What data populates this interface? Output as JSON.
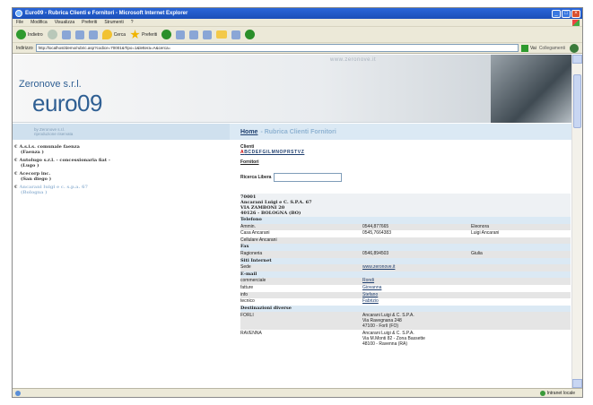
{
  "window": {
    "title": "Euro09 - Rubrica Clienti e Fornitori - Microsoft Internet Explorer",
    "minimize": "_",
    "maximize": "□",
    "close": "×"
  },
  "menu": [
    "File",
    "Modifica",
    "Visualizza",
    "Preferiti",
    "Strumenti",
    "?"
  ],
  "toolbar": {
    "back": "Indietro",
    "search": "Cerca",
    "favorites": "Preferiti"
  },
  "address": {
    "label": "Indirizzo",
    "url": "http://localhost/demo/rubric.asp?codice=70001&Tipo=1&lettera=A&cerca=",
    "go": "Vai",
    "links": "Collegamenti"
  },
  "header": {
    "company": "Zeronove s.r.l.",
    "brand": "euro09",
    "website": "www.zeronove.it",
    "byline_1": "by Zeronove s.r.l.",
    "byline_2": "riproduzione riservata"
  },
  "breadcrumb": {
    "home": "Home",
    "current": "- Rubrica Clienti Fornitori"
  },
  "sidebar": {
    "items": [
      {
        "name": "A.s.i.s. comunale faenza",
        "city": "(Faenza )"
      },
      {
        "name": "Autolugo s.r.l. - concessionaria fiat -",
        "city": "(Lugo )"
      },
      {
        "name": "Acecorp inc.",
        "city": "(San diego )"
      },
      {
        "name": "Ancarani luigi e c. s.p.a. 67",
        "city": "(Bologna )"
      }
    ]
  },
  "main": {
    "clienti_label": "Clienti",
    "alphabet_first": "A",
    "alphabet_rest": "BCDEFGILMNOPRSTVZ",
    "fornitori_label": "Fornitori",
    "ricerca_label": "Ricerca Libera",
    "ricerca_value": "",
    "code": "70001",
    "company": "Ancarani Luigi e C. S.P.A. 67",
    "street": "VIA ZAMBONI 20",
    "cityline": "40126 - BOLOGNA (BO)"
  },
  "details": {
    "telefono_label": "Telefono",
    "telefono": [
      [
        "Ammin.",
        "0544,877665",
        "Eleonora"
      ],
      [
        "Casa Ancarani",
        "0545,7664383",
        "Luigi Ancarani"
      ],
      [
        "Cellulare Ancarani",
        "",
        ""
      ]
    ],
    "fax_label": "Fax",
    "fax": [
      [
        "Ragioneria",
        "0546,894503",
        "Giulia"
      ]
    ],
    "siti_label": "Siti Internet",
    "siti": [
      [
        "Sede",
        "www.zeronove.it",
        ""
      ]
    ],
    "email_label": "E-mail",
    "email": [
      [
        "commerciale",
        "Rondi"
      ],
      [
        "fatture",
        "Giovanna"
      ],
      [
        "info",
        "Stefano"
      ],
      [
        "tecnico",
        "Fabrizio"
      ]
    ],
    "dest_label": "Destinazioni diverse",
    "dest": [
      {
        "city": "FORLI",
        "l1": "Ancarani Luigi & C. S.P.A.",
        "l2": "Via Ravegnana 248",
        "l3": "47100 - Forlì (FO)"
      },
      {
        "city": "RAVENNA",
        "l1": "Ancarani Luigi & C. S.P.A.",
        "l2": "Via M.Monti 82 - Zona Bassette",
        "l3": "48100 - Ravenna (RA)"
      }
    ]
  },
  "status": {
    "zone": "Intranet locale"
  }
}
